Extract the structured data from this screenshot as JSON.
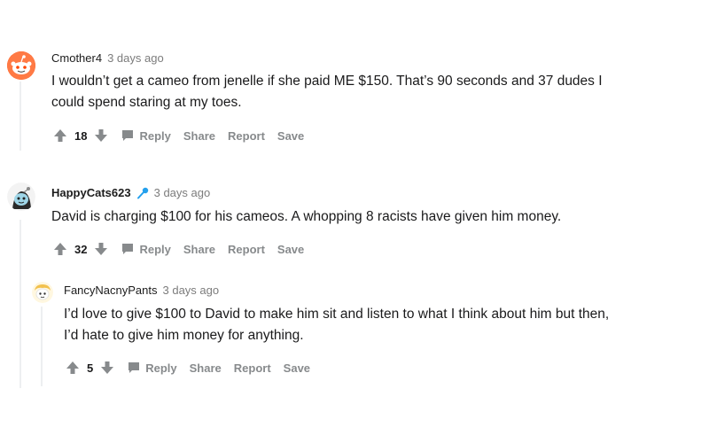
{
  "comments": [
    {
      "username": "Cmother4",
      "time": "3 days ago",
      "body_lines": [
        "I wouldn’t get a cameo from jenelle if she paid ME $150. That’s 90 seconds and 37 dudes I",
        "could spend staring at my toes."
      ],
      "score": "18",
      "avatar_icon": "reddit-snoo-avatar-icon"
    },
    {
      "username": "HappyCats623",
      "time": "3 days ago",
      "body_lines": [
        "David is charging $100 for his cameos. A whopping 8 racists have given him money."
      ],
      "score": "32",
      "flair_icon": "microphone-icon",
      "avatar_icon": "snoo-avatar-icon"
    },
    {
      "username": "FancyNacnyPants",
      "time": "3 days ago",
      "body_lines": [
        "I’d love to give $100 to David to make him sit and listen to what I think about him but then,",
        "I’d hate to give him money for anything."
      ],
      "score": "5",
      "avatar_icon": "snoo-avatar-icon"
    }
  ],
  "actions": {
    "reply": "Reply",
    "share": "Share",
    "report": "Report",
    "save": "Save"
  },
  "colors": {
    "accent_orange": "#ff4500",
    "muted": "#878a8c",
    "thread_line": "#edeff1"
  }
}
